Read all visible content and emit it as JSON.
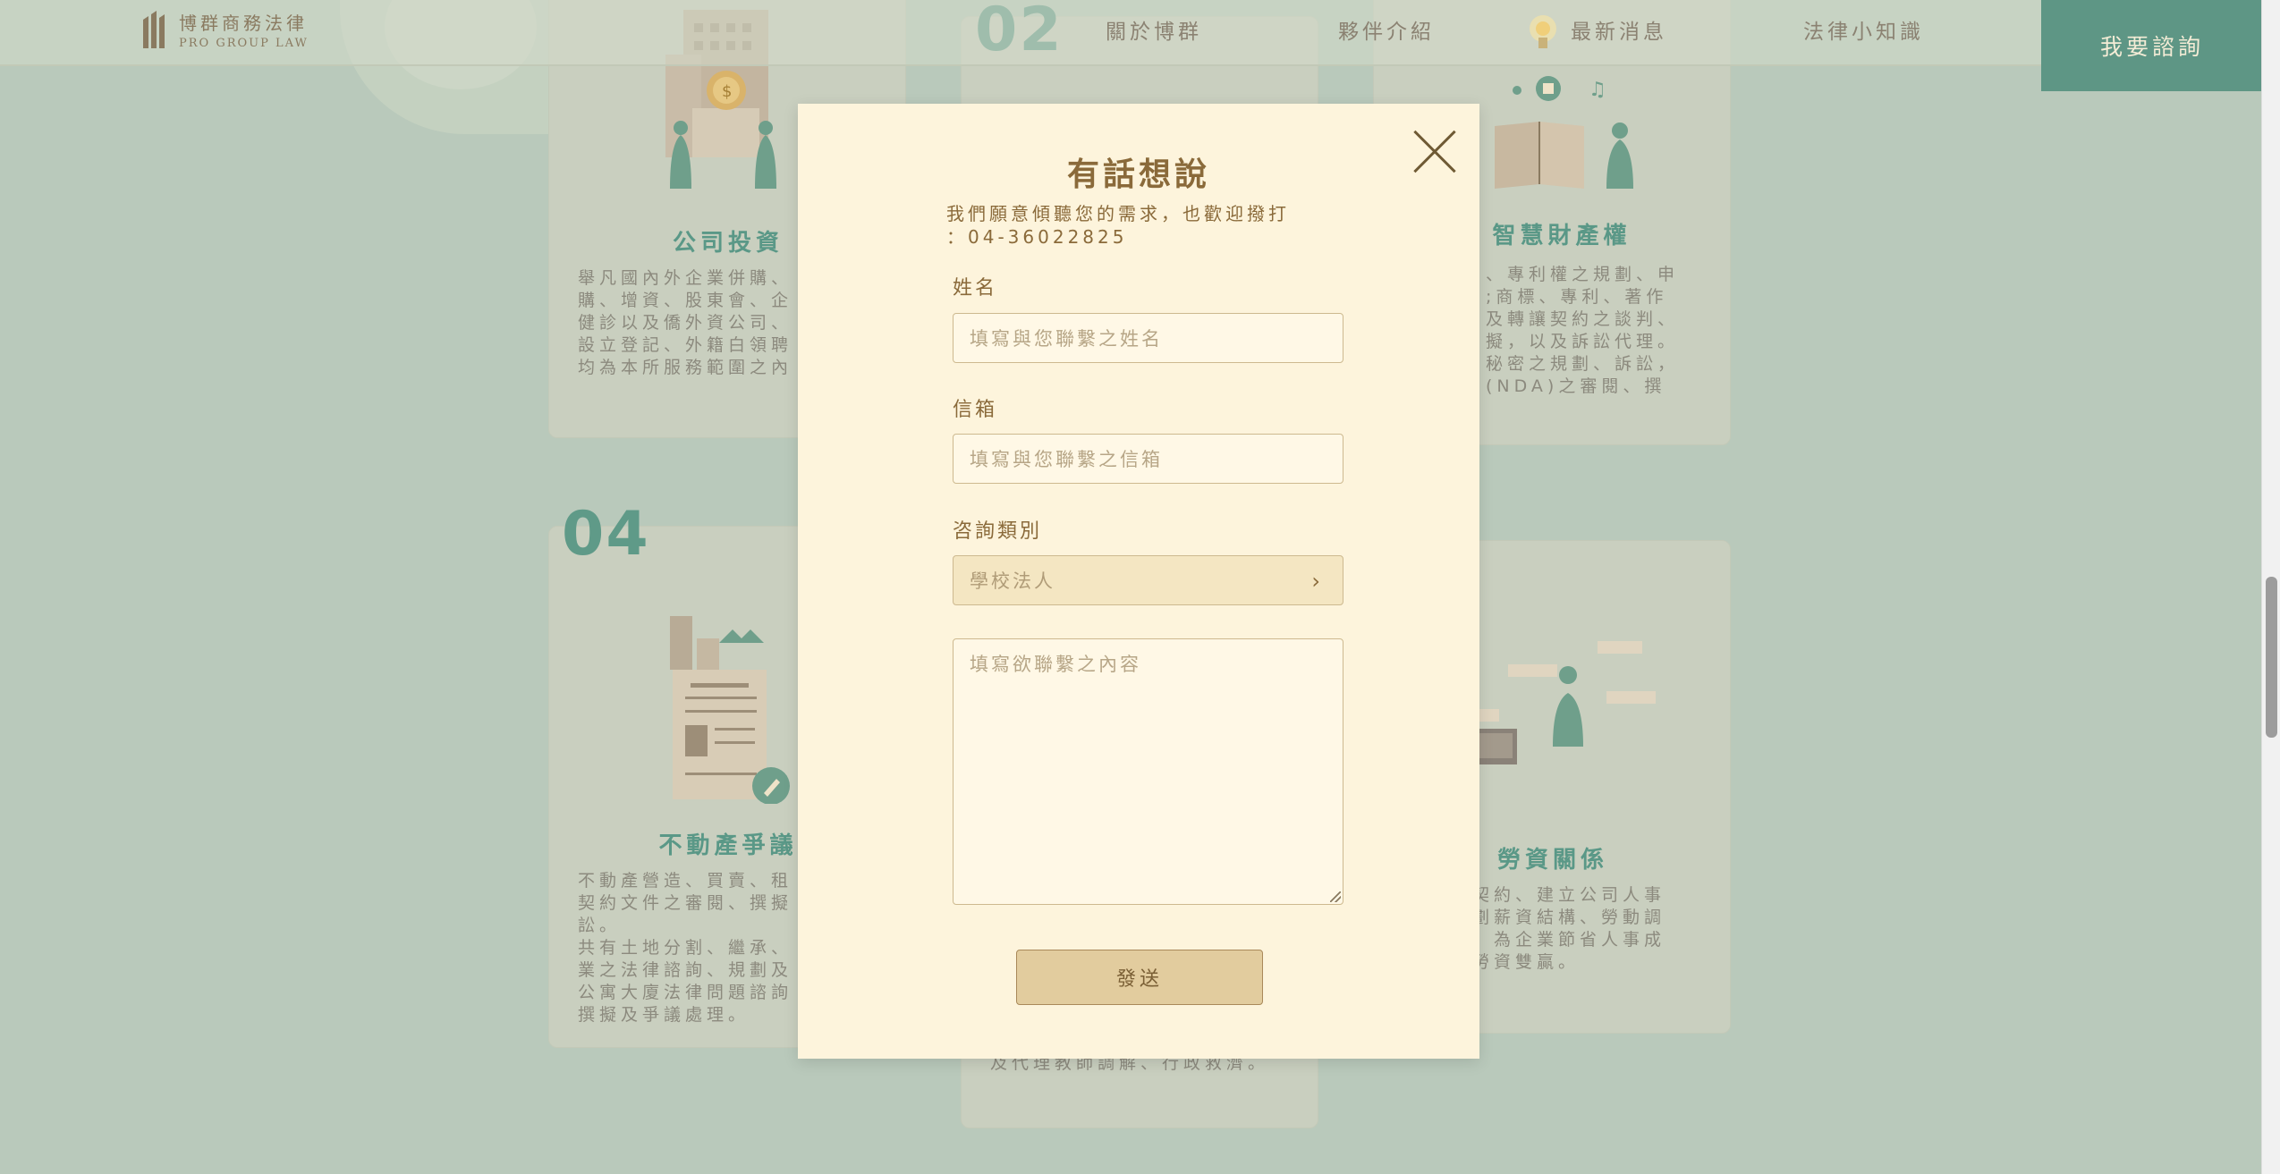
{
  "header": {
    "logo_cn": "博群商務法律",
    "logo_en": "PRO GROUP LAW",
    "nav": [
      "關於博群",
      "夥伴介紹",
      "最新消息",
      "法律小知識"
    ],
    "cta": "我要諮詢"
  },
  "cards": {
    "c1_title": "公司投資",
    "c1_desc": "舉凡國內外企業併購、\n購、增資、股東會、企\n健診以及僑外資公司、\n設立登記、外籍白領聘\n均為本所服務範圍之內",
    "c2_num": "02",
    "c3_title": "智慧財產權",
    "c3_desc": "、專利權之規劃、申\n;商標、專利、著作\n及轉讓契約之談判、\n擬，以及訴訟代理。\n秘密之規劃、訴訟，\n(NDA)之審閱、撰",
    "c4_num": "04",
    "c4_title": "不動產爭議",
    "c4_desc": "不動產營造、買賣、租\n契約文件之審閱、撰擬\n訟。\n共有土地分割、繼承、\n業之法律諮詢、規劃及\n公寓大廈法律問題諮詢\n撰擬及爭議處理。",
    "c5_desc": "及代理教師調解、行政救濟。",
    "c6_title": "勞資關係",
    "c6_desc": "契約、建立公司人事\n劃薪資結構、勞動調\n，為企業節省人事成\n勞資雙贏。"
  },
  "modal": {
    "title": "有話想說",
    "subtitle": "我們願意傾聽您的需求，也歡迎撥打\n：04-36022825",
    "name_label": "姓名",
    "name_placeholder": "填寫與您聯繫之姓名",
    "email_label": "信箱",
    "email_placeholder": "填寫與您聯繫之信箱",
    "category_label": "咨詢類別",
    "category_value": "學校法人",
    "content_placeholder": "填寫欲聯繫之內容",
    "submit": "發送"
  },
  "colors": {
    "background": "#b9c9bb",
    "modal_bg": "#fdf4dc",
    "accent_green": "#5e9685",
    "accent_brown": "#8a6a3a"
  }
}
